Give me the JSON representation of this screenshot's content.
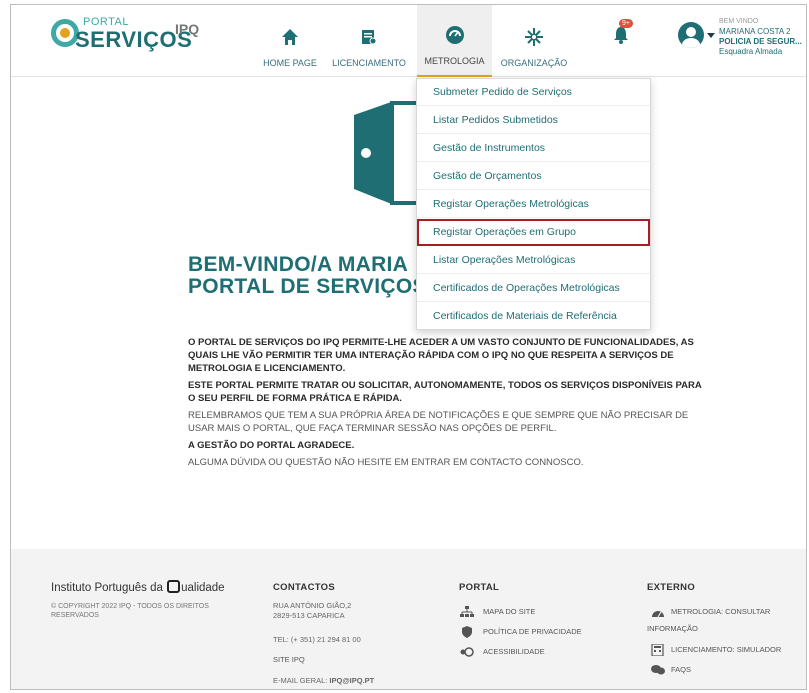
{
  "header": {
    "logo_top": "PORTAL",
    "logo_main": "SERVIÇOS",
    "ipq": "IPQ",
    "nav": [
      {
        "label": "HOME PAGE",
        "icon": "home-icon"
      },
      {
        "label": "LICENCIAMENTO",
        "icon": "document-icon"
      },
      {
        "label": "METROLOGIA",
        "icon": "gauge-icon",
        "active": true
      },
      {
        "label": "ORGANIZAÇÃO",
        "icon": "network-icon"
      }
    ],
    "notification_badge": "9+",
    "user": {
      "welcome": "BEM VINDO",
      "name": "MARIANA COSTA 2",
      "org": "POLICIA DE SEGUR...",
      "unit": "Esquadra Almada"
    }
  },
  "dropdown": {
    "items": [
      "Submeter Pedido de Serviços",
      "Listar Pedidos Submetidos",
      "Gestão de Instrumentos",
      "Gestão de Orçamentos",
      "Registar Operações Metrológicas",
      "Registar Operações em Grupo",
      "Listar Operações Metrológicas",
      "Certificados de Operações Metrológicas",
      "Certificados de Materiais de Referência"
    ],
    "highlighted_index": 5
  },
  "hero": {
    "title_line1": "BEM-VINDO/A MARIA",
    "title_line2": "PORTAL DE SERVIÇOS",
    "p1": "O PORTAL DE SERVIÇOS DO IPQ PERMITE-LHE ACEDER A UM VASTO CONJUNTO DE FUNCIONALIDADES, AS QUAIS LHE VÃO PERMITIR TER UMA INTERAÇÃO RÁPIDA COM O IPQ NO QUE RESPEITA A SERVIÇOS DE METROLOGIA E LICENCIAMENTO.",
    "p2": "ESTE PORTAL PERMITE TRATAR OU SOLICITAR, AUTONOMAMENTE, TODOS OS SERVIÇOS DISPONÍVEIS PARA O SEU PERFIL DE FORMA PRÁTICA E RÁPIDA.",
    "p3": "RELEMBRAMOS QUE TEM A SUA PRÓPRIA ÁREA DE NOTIFICAÇÕES E QUE SEMPRE QUE NÃO PRECISAR DE USAR MAIS O PORTAL, QUE FAÇA TERMINAR SESSÃO NAS OPÇÕES DE PERFIL.",
    "p4": "A GESTÃO DO PORTAL AGRADECE.",
    "p5": "ALGUMA DÚVIDA OU QUESTÃO NÃO HESITE EM ENTRAR EM CONTACTO CONNOSCO."
  },
  "footer": {
    "brand_before": "Instituto Português da",
    "brand_after": "ualidade",
    "copyright": "© COPYRIGHT 2022 IPQ - TODOS OS DIREITOS RESERVADOS",
    "contactos": {
      "heading": "CONTACTOS",
      "address1": "RUA ANTÓNIO GIÃO,2",
      "address2": "2829-513 CAPARICA",
      "tel": "TEL: (+ 351) 21 294 81 00",
      "site": "SITE IPQ",
      "email_label": "E-MAIL GERAL:",
      "email": "IPQ@IPQ.PT"
    },
    "portal": {
      "heading": "PORTAL",
      "links": [
        "MAPA DO SITE",
        "POLÍTICA DE PRIVACIDADE",
        "ACESSIBILIDADE"
      ]
    },
    "externo": {
      "heading": "EXTERNO",
      "link1a": "METROLOGIA: CONSULTAR",
      "link1b": "INFORMAÇÃO",
      "link2": "LICENCIAMENTO: SIMULADOR",
      "link3": "FAQS"
    }
  },
  "colors": {
    "teal": "#1f6e73",
    "accent": "#e4a21a",
    "highlight_border": "#a61d24",
    "notification": "#e74c3c"
  }
}
